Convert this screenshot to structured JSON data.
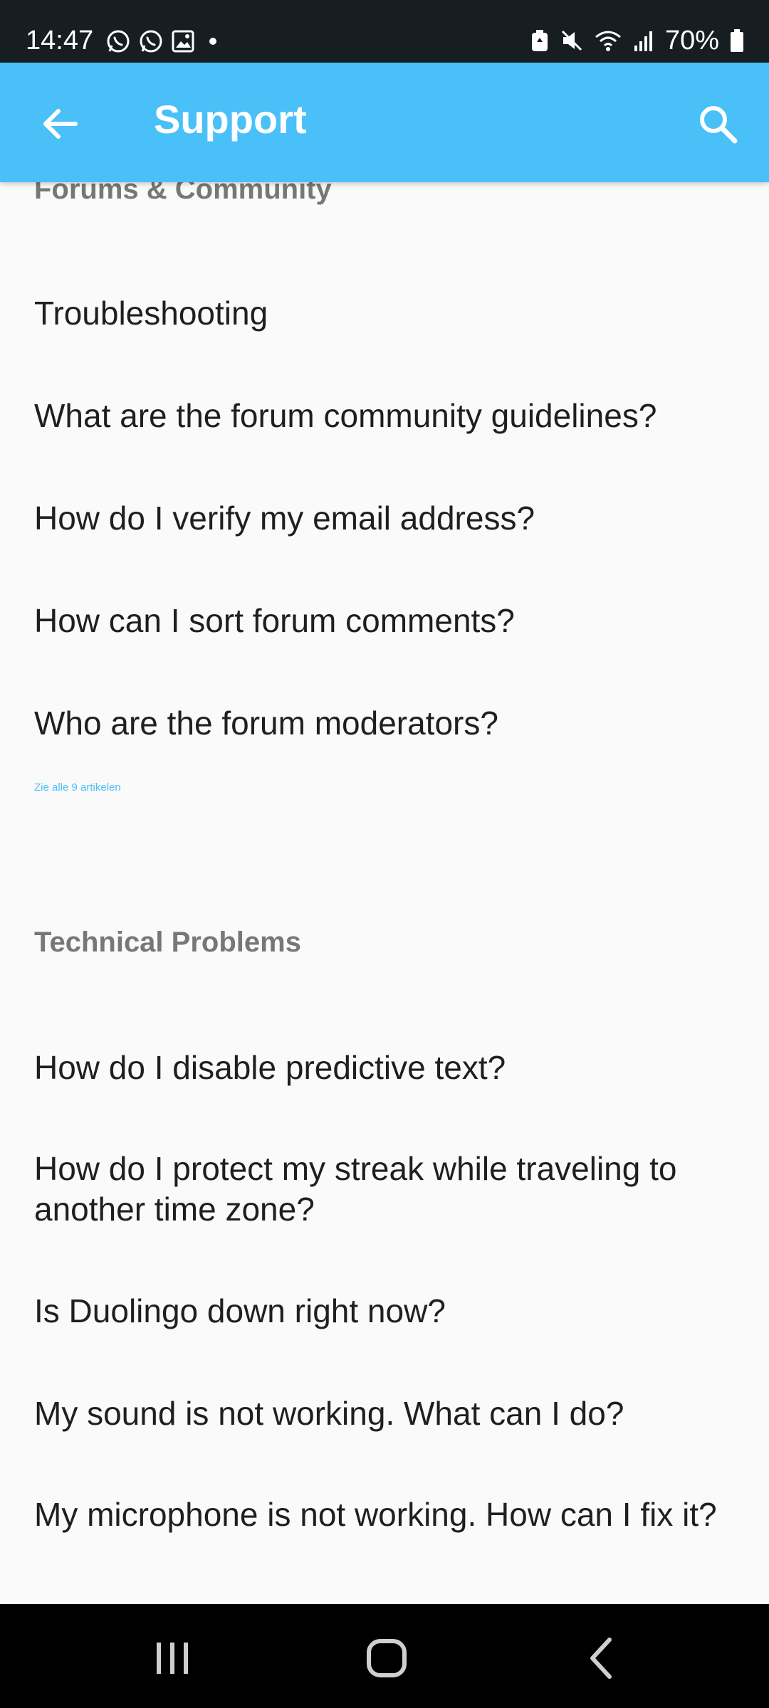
{
  "status_bar": {
    "time": "14:47",
    "battery": "70%",
    "left_icons": [
      "whatsapp-icon",
      "whatsapp-icon",
      "gallery-icon",
      "dot-icon"
    ],
    "right_icons": [
      "battery-saver-icon",
      "mute-icon",
      "wifi-icon",
      "signal-icon",
      "battery-icon"
    ]
  },
  "app_bar": {
    "title": "Support",
    "back_icon": "arrow-left-icon",
    "search_icon": "search-icon",
    "color": "#49c0f8"
  },
  "sections": [
    {
      "title": "Forums & Community",
      "articles": [
        "Troubleshooting",
        "What are the forum community guidelines?",
        "How do I verify my email address?",
        "How can I sort forum comments?",
        "Who are the forum moderators?"
      ],
      "see_all": "Zie alle 9 artikelen"
    },
    {
      "title": "Technical Problems",
      "articles": [
        "How do I disable predictive text?",
        "How do I protect my streak while traveling to another time zone?",
        "Is Duolingo down right now?",
        "My sound is not working. What can I do?",
        "My microphone is not working. How can I fix it?"
      ]
    }
  ],
  "nav_bar": {
    "buttons": [
      "recent-apps-icon",
      "home-icon",
      "back-icon"
    ]
  }
}
